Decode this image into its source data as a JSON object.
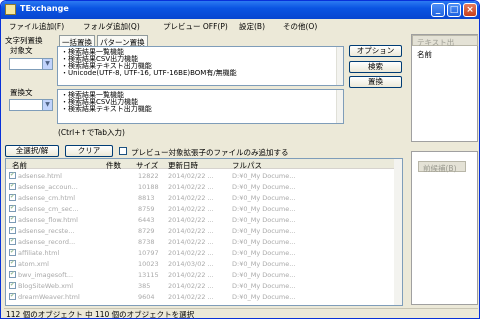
{
  "window": {
    "title": "TExchange"
  },
  "menu": [
    "ファイル追加(F)",
    "フォルダ追加(Q)",
    "プレビュー OFF(P)",
    "設定(B)",
    "その他(O)"
  ],
  "left": {
    "target_label": "文字列置換",
    "search_label": "対象文",
    "replace_label": "置換文"
  },
  "tabs": [
    "一括置換",
    "パターン置換"
  ],
  "search_lines": [
    "・検索結果一覧機能",
    "・検索結果CSV出力機能",
    "・検索結果テキスト出力機能",
    "・Unicode(UTF-8, UTF-16, UTF-16BE)BOM有/無機能"
  ],
  "replace_lines": [
    "・検索結果一覧機能",
    "・検索結果CSV出力機能",
    "・検索結果テキスト出力機能"
  ],
  "hint": "(Ctrl+↑でTab入力)",
  "buttons": {
    "options": "オプション",
    "search": "検索",
    "replace": "置換",
    "select_all": "全選択/解",
    "clear": "クリア"
  },
  "preview_option": "プレビュー対象拡張子のファイルのみ追加する",
  "right": {
    "text_header": "テキスト出",
    "name_col": "名前",
    "before_label": "前候補(B)"
  },
  "table": {
    "columns": [
      "名前",
      "件数",
      "サイズ",
      "更新日時",
      "フルパス"
    ],
    "rows": [
      [
        "adsense.html",
        "",
        "12822",
        "2014/02/22 ...",
        "D:¥0_My Docume..."
      ],
      [
        "adsense_accoun...",
        "",
        "10188",
        "2014/02/22 ...",
        "D:¥0_My Docume..."
      ],
      [
        "adsense_cm.html",
        "",
        "8813",
        "2014/02/22 ...",
        "D:¥0_My Docume..."
      ],
      [
        "adsense_cm_sec...",
        "",
        "8759",
        "2014/02/22 ...",
        "D:¥0_My Docume..."
      ],
      [
        "adsense_flow.html",
        "",
        "6443",
        "2014/02/22 ...",
        "D:¥0_My Docume..."
      ],
      [
        "adsense_recste...",
        "",
        "8729",
        "2014/02/22 ...",
        "D:¥0_My Docume..."
      ],
      [
        "adsense_record...",
        "",
        "8738",
        "2014/02/22 ...",
        "D:¥0_My Docume..."
      ],
      [
        "affiliate.html",
        "",
        "10797",
        "2014/02/22 ...",
        "D:¥0_My Docume..."
      ],
      [
        "atom.xml",
        "",
        "10023",
        "2014/03/02 ...",
        "D:¥0_My Docume..."
      ],
      [
        "bwv_imagesoft...",
        "",
        "13115",
        "2014/02/22 ...",
        "D:¥0_My Docume..."
      ],
      [
        "BlogSiteWeb.xml",
        "",
        "385",
        "2014/02/22 ...",
        "D:¥0_My Docume..."
      ],
      [
        "dreamWeaver.html",
        "",
        "9604",
        "2014/02/22 ...",
        "D:¥0_My Docume..."
      ]
    ]
  },
  "status": "112 個のオブジェクト 中 110 個のオブジェクトを選択"
}
